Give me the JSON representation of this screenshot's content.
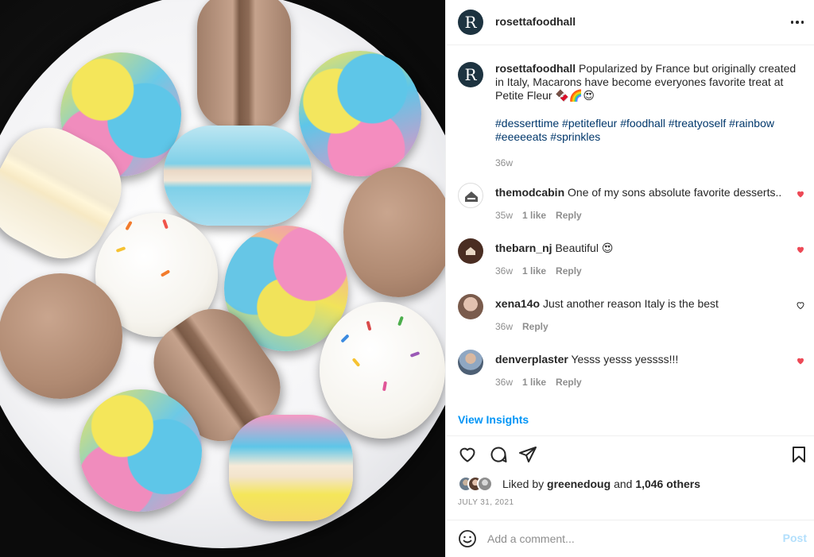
{
  "post": {
    "username": "rosettafoodhall",
    "avatar_letter": "R",
    "photo_alt": "macarons",
    "more_icon": "more-horizontal-icon"
  },
  "caption": {
    "username": "rosettafoodhall",
    "text": "Popularized by France but originally created in Italy, Macarons have become everyones favorite treat at Petite Fleur 🍫🌈😍",
    "hashtags": "#desserttime #petitefleur #foodhall #treatyoself #rainbow #eeeeeats #sprinkles",
    "time": "36w"
  },
  "comments": [
    {
      "username": "themodcabin",
      "text": "One of my sons absolute favorite desserts...",
      "time": "35w",
      "likes": "1 like",
      "reply": "Reply",
      "liked": true
    },
    {
      "username": "thebarn_nj",
      "text": "Beautiful 😍",
      "time": "36w",
      "likes": "1 like",
      "reply": "Reply",
      "liked": true
    },
    {
      "username": "xena14o",
      "text": "Just another reason Italy is the best",
      "time": "36w",
      "likes": "",
      "reply": "Reply",
      "liked": false
    },
    {
      "username": "denverplaster",
      "text": "Yesss yesss yessss!!!",
      "time": "36w",
      "likes": "1 like",
      "reply": "Reply",
      "liked": true
    }
  ],
  "insights_label": "View Insights",
  "likes": {
    "prefix": "Liked by",
    "user": "greenedoug",
    "and": "and",
    "others": "1,046 others"
  },
  "date": "JULY 31, 2021",
  "comment_box": {
    "placeholder": "Add a comment...",
    "post_label": "Post"
  },
  "colors": {
    "link": "#00376b",
    "accent": "#0095f6",
    "heart": "#ed4956",
    "muted": "#8e8e8e",
    "post_disabled": "#b2dffc"
  }
}
